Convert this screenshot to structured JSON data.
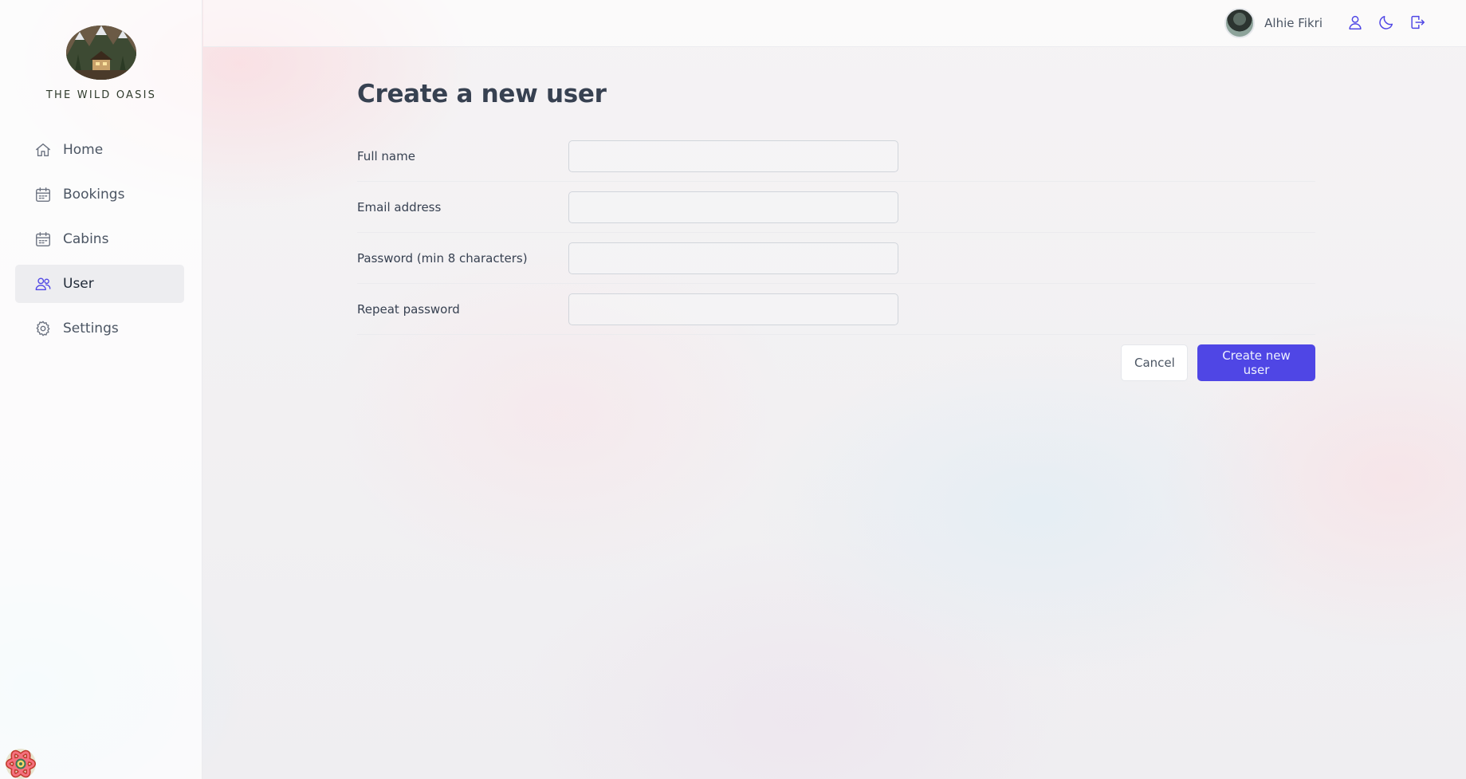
{
  "sidebar": {
    "brand": "THE WILD OASIS",
    "items": [
      {
        "label": "Home",
        "icon": "home-icon",
        "active": false
      },
      {
        "label": "Bookings",
        "icon": "calendar-icon",
        "active": false
      },
      {
        "label": "Cabins",
        "icon": "calendar-icon",
        "active": false
      },
      {
        "label": "User",
        "icon": "users-icon",
        "active": true
      },
      {
        "label": "Settings",
        "icon": "gear-icon",
        "active": false
      }
    ]
  },
  "header": {
    "user_name": "Alhie Fikri",
    "icons": [
      "user-icon",
      "moon-icon",
      "logout-icon"
    ]
  },
  "main": {
    "title": "Create a new user",
    "fields": [
      {
        "label": "Full name",
        "value": "",
        "placeholder": ""
      },
      {
        "label": "Email address",
        "value": "",
        "placeholder": ""
      },
      {
        "label": "Password (min 8 characters)",
        "value": "",
        "placeholder": ""
      },
      {
        "label": "Repeat password",
        "value": "",
        "placeholder": ""
      }
    ],
    "cancel_label": "Cancel",
    "submit_label": "Create new user"
  },
  "colors": {
    "accent": "#4f46e5",
    "active_nav_bg": "#ebebee"
  }
}
